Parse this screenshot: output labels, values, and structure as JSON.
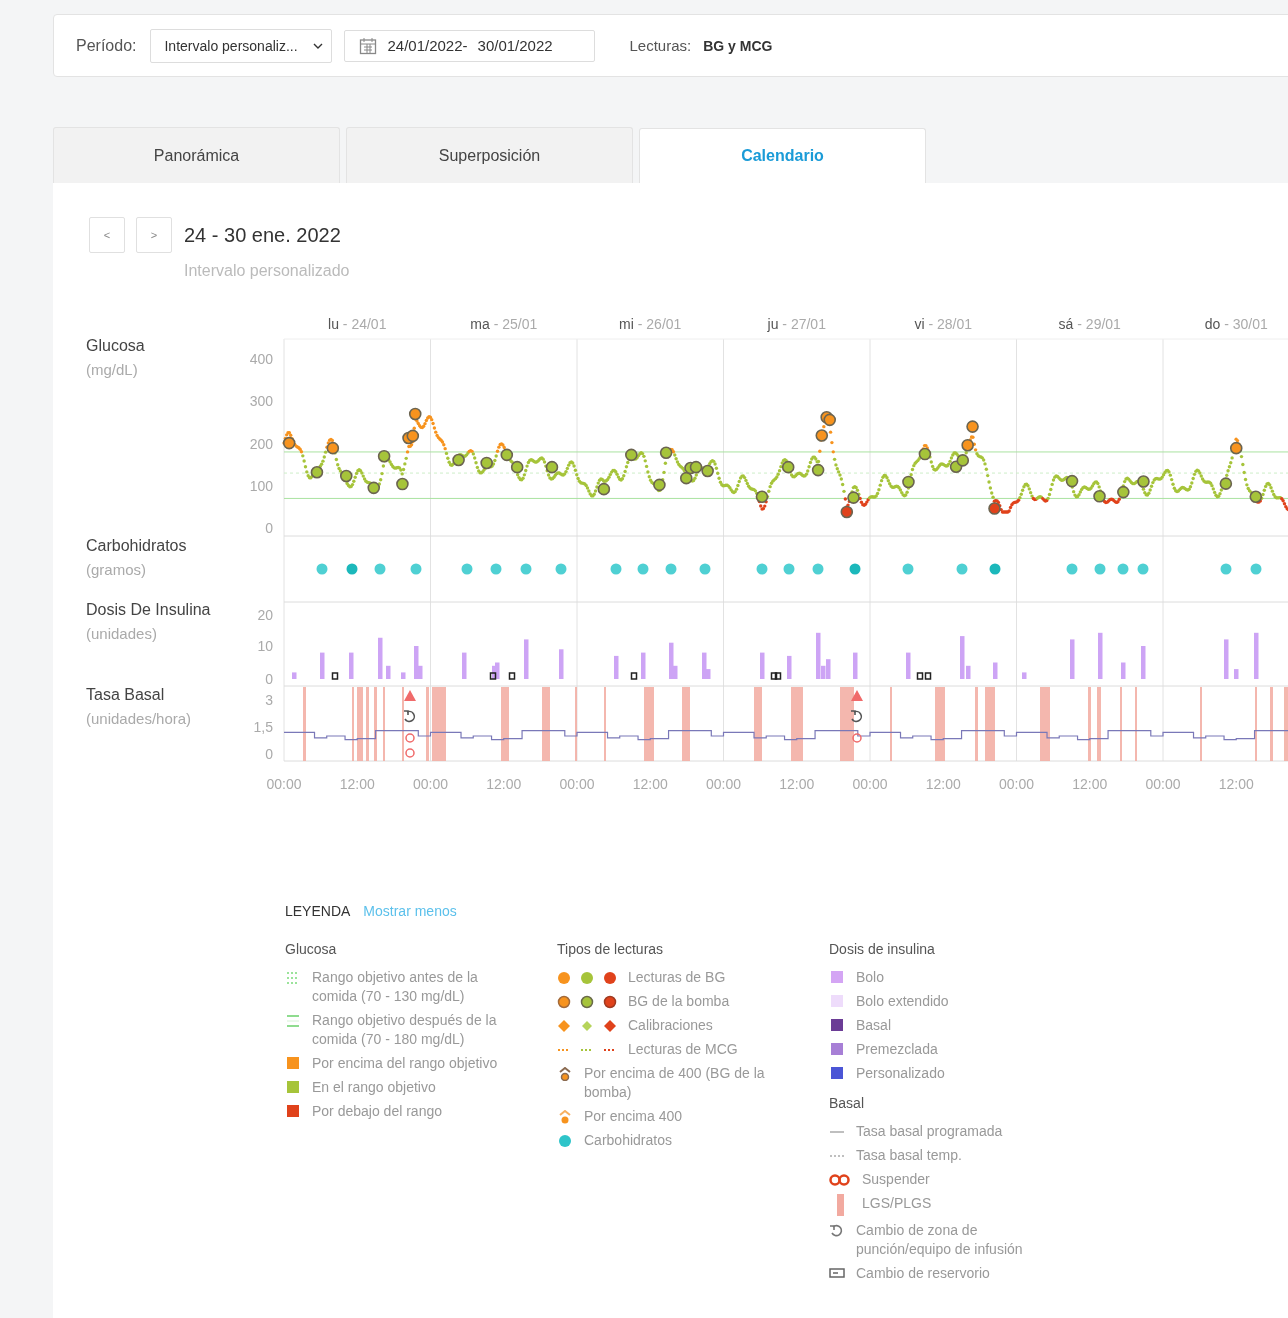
{
  "filter_bar": {
    "period_label": "Período:",
    "period_value": "Intervalo personaliz...",
    "date_start": "24/01/2022-",
    "date_end": "30/01/2022",
    "readings_label": "Lecturas:",
    "readings_value": "BG y MCG"
  },
  "tabs": [
    {
      "label": "Panorámica",
      "selected": false
    },
    {
      "label": "Superposición",
      "selected": false
    },
    {
      "label": "Calendario",
      "selected": true
    }
  ],
  "week_nav": {
    "prev": "<",
    "next": ">",
    "title": "24 - 30 ene. 2022",
    "subtitle": "Intervalo personalizado"
  },
  "chart": {
    "day_labels": [
      {
        "day": "lu",
        "date": "- 24/01"
      },
      {
        "day": "ma",
        "date": "- 25/01"
      },
      {
        "day": "mi",
        "date": "- 26/01"
      },
      {
        "day": "ju",
        "date": "- 27/01"
      },
      {
        "day": "vi",
        "date": "- 28/01"
      },
      {
        "day": "sá",
        "date": "- 29/01"
      },
      {
        "day": "do",
        "date": "- 30/01"
      }
    ],
    "panels": [
      {
        "title": "Glucosa",
        "unit": "(mg/dL)",
        "ticks": [
          "400",
          "300",
          "200",
          "100",
          "0"
        ]
      },
      {
        "title": "Carbohidratos",
        "unit": "(gramos)"
      },
      {
        "title": "Dosis De Insulina",
        "unit": "(unidades)",
        "ticks": [
          "20",
          "10",
          "0"
        ]
      },
      {
        "title": "Tasa Basal",
        "unit": "(unidades/hora)",
        "ticks": [
          "3",
          "1,5",
          "0"
        ]
      }
    ],
    "time_labels": [
      "00:00",
      "12:00",
      "00:00",
      "12:00",
      "00:00",
      "12:00",
      "00:00",
      "12:00",
      "00:00",
      "12:00",
      "00:00",
      "12:00",
      "00:00",
      "12:00"
    ]
  },
  "legend": {
    "title": "LEYENDA",
    "toggle": "Mostrar menos",
    "columns": [
      {
        "groups": [
          {
            "heading": "Glucosa",
            "items": [
              {
                "kind": "dotted-range",
                "label": "Rango objetivo antes de la comida (70 - 130 mg/dL)"
              },
              {
                "kind": "solid-range",
                "label": "Rango objetivo después de la comida (70 - 180 mg/dL)"
              },
              {
                "kind": "square",
                "color": "#f7931e",
                "label": "Por encima del rango objetivo"
              },
              {
                "kind": "square",
                "color": "#a6c43a",
                "label": "En el rango objetivo"
              },
              {
                "kind": "square",
                "color": "#e0421b",
                "label": "Por debajo del rango"
              }
            ]
          }
        ]
      },
      {
        "groups": [
          {
            "heading": "Tipos de lecturas",
            "items": [
              {
                "kind": "dots",
                "label": "Lecturas de BG"
              },
              {
                "kind": "rings",
                "label": "BG de la bomba"
              },
              {
                "kind": "diamonds",
                "label": "Calibraciones"
              },
              {
                "kind": "dashes",
                "label": "Lecturas de MCG"
              },
              {
                "kind": "pump-above",
                "label": "Por encima de 400 (BG de la bomba)"
              },
              {
                "kind": "above",
                "label": "Por encima 400"
              },
              {
                "kind": "dot",
                "color": "#2ec4c9",
                "label": "Carbohidratos"
              }
            ]
          }
        ]
      },
      {
        "groups": [
          {
            "heading": "Dosis de insulina",
            "items": [
              {
                "kind": "square",
                "color": "#d4a5f4",
                "label": "Bolo"
              },
              {
                "kind": "square",
                "color": "#eedcfb",
                "label": "Bolo extendido"
              },
              {
                "kind": "square",
                "color": "#6b3c96",
                "label": "Basal"
              },
              {
                "kind": "square",
                "color": "#a77fd6",
                "label": "Premezclada"
              },
              {
                "kind": "square",
                "color": "#4b55d6",
                "label": "Personalizado"
              }
            ]
          },
          {
            "heading": "Basal",
            "items": [
              {
                "kind": "line",
                "label": "Tasa basal programada"
              },
              {
                "kind": "dashed-line",
                "label": "Tasa basal temp."
              },
              {
                "kind": "suspend",
                "label": "Suspender"
              },
              {
                "kind": "bar",
                "label": "LGS/PLGS"
              },
              {
                "kind": "site-change",
                "label": "Cambio de zona de punción/equipo de infusión"
              },
              {
                "kind": "reservoir",
                "label": "Cambio de reservorio"
              }
            ]
          }
        ]
      }
    ]
  }
}
